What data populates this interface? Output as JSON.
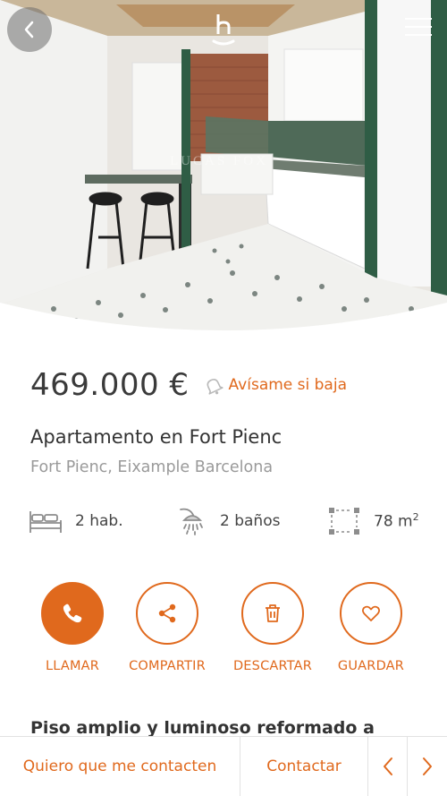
{
  "hero": {
    "watermark": "LUCAS FOX",
    "icons": {
      "back": "chevron-left-icon",
      "logo": "brand-h-logo",
      "menu": "hamburger-menu-icon"
    }
  },
  "listing": {
    "price": "469.000 €",
    "price_alert_label": "Avísame si baja",
    "title": "Apartamento en Fort Pienc",
    "location": "Fort Pienc, Eixample Barcelona"
  },
  "features": {
    "bedrooms": "2 hab.",
    "bathrooms": "2 baños",
    "area": "78 m",
    "area_unit_sup": "2"
  },
  "actions": {
    "call": "LLAMAR",
    "share": "COMPARTIR",
    "discard": "DESCARTAR",
    "save": "GUARDAR"
  },
  "description": {
    "heading": "Piso amplio y luminoso reformado a"
  },
  "bottom_bar": {
    "request_contact": "Quiero que me contacten",
    "contact": "Contactar"
  },
  "colors": {
    "accent": "#e0691d",
    "text_dark": "#333333",
    "text_muted": "#9a9a9a",
    "door_green": "#2f5d45"
  }
}
